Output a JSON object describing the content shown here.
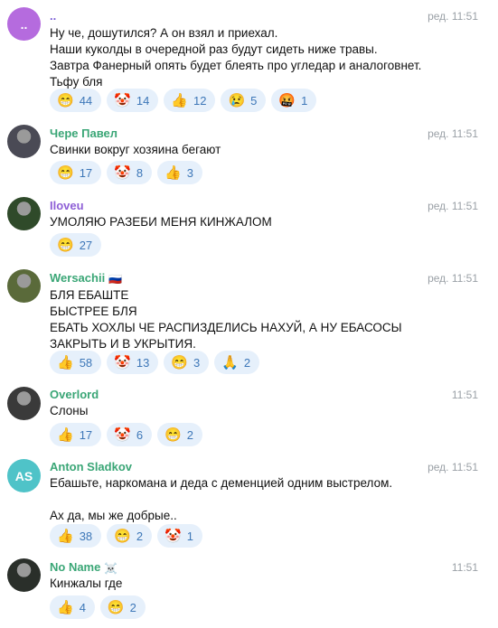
{
  "colors": {
    "reaction_bg": "#e6f0fb",
    "reaction_text": "#3d77b8",
    "time_text": "#9aa0a6"
  },
  "messages": [
    {
      "name": "..",
      "name_color": "#7b5fd6",
      "avatar_initials": "..",
      "avatar_color": "#b56bde",
      "avatar_icon": "dots-avatar",
      "time": "ред. 11:51",
      "text": "Ну че, дошутился? А он взял и приехал.\nНаши куколды в очередной раз будут сидеть ниже травы.\nЗавтра Фанерный опять будет блеять про угледар и аналоговнет.\nТьфу бля",
      "reactions": [
        {
          "emoji": "😁",
          "icon": "grin-icon",
          "count": "44"
        },
        {
          "emoji": "🤡",
          "icon": "clown-icon",
          "count": "14"
        },
        {
          "emoji": "👍",
          "icon": "thumbs-up-icon",
          "count": "12"
        },
        {
          "emoji": "😢",
          "icon": "crying-icon",
          "count": "5"
        },
        {
          "emoji": "🤬",
          "icon": "cursing-icon",
          "count": "1"
        }
      ]
    },
    {
      "name": "Чере Павел",
      "name_color": "#3aa676",
      "avatar_icon": "photo-avatar",
      "avatar_color": "#4a4a55",
      "time": "ред. 11:51",
      "text": "Свинки вокруг хозяина бегают",
      "reactions": [
        {
          "emoji": "😁",
          "icon": "grin-icon",
          "count": "17"
        },
        {
          "emoji": "🤡",
          "icon": "clown-icon",
          "count": "8"
        },
        {
          "emoji": "👍",
          "icon": "thumbs-up-icon",
          "count": "3"
        }
      ]
    },
    {
      "name": "Iloveu",
      "name_color": "#8e5fd6",
      "avatar_icon": "photo-avatar",
      "avatar_color": "#2f4a2a",
      "time": "ред. 11:51",
      "text": "УМОЛЯЮ РАЗЕБИ МЕНЯ КИНЖАЛОМ",
      "reactions": [
        {
          "emoji": "😁",
          "icon": "grin-icon",
          "count": "27"
        }
      ]
    },
    {
      "name": "Wersachii",
      "name_flag": "🇷🇺",
      "name_color": "#3aa676",
      "avatar_icon": "photo-avatar",
      "avatar_color": "#5a6a3a",
      "time": "ред. 11:51",
      "text": "БЛЯ ЕБАШТЕ\nБЫСТРЕЕ БЛЯ\nЕБАТЬ ХОХЛЫ ЧЕ РАСПИЗДЕЛИСЬ НАХУЙ, А НУ ЕБАСОСЫ\nЗАКРЫТЬ И В УКРЫТИЯ.",
      "reactions": [
        {
          "emoji": "👍",
          "icon": "thumbs-up-icon",
          "count": "58"
        },
        {
          "emoji": "🤡",
          "icon": "clown-icon",
          "count": "13"
        },
        {
          "emoji": "😁",
          "icon": "grin-icon",
          "count": "3"
        },
        {
          "emoji": "🙏",
          "icon": "pray-icon",
          "count": "2"
        }
      ]
    },
    {
      "name": "Overlord",
      "name_color": "#3aa676",
      "avatar_icon": "photo-avatar",
      "avatar_color": "#3a3a3a",
      "time": "11:51",
      "text": "Слоны",
      "reactions": [
        {
          "emoji": "👍",
          "icon": "thumbs-up-icon",
          "count": "17"
        },
        {
          "emoji": "🤡",
          "icon": "clown-icon",
          "count": "6"
        },
        {
          "emoji": "😁",
          "icon": "grin-icon",
          "count": "2"
        }
      ]
    },
    {
      "name": "Anton Sladkov",
      "name_color": "#3aa676",
      "avatar_initials": "AS",
      "avatar_color": "#4fc3c8",
      "time": "ред. 11:51",
      "text": "Ебашьте, наркомана и деда с деменцией одним выстрелом.\n\nАх да, мы же добрые..",
      "reactions": [
        {
          "emoji": "👍",
          "icon": "thumbs-up-icon",
          "count": "38"
        },
        {
          "emoji": "😁",
          "icon": "grin-icon",
          "count": "2"
        },
        {
          "emoji": "🤡",
          "icon": "clown-icon",
          "count": "1"
        }
      ]
    },
    {
      "name": "No Name",
      "name_flag": "☠️",
      "name_color": "#3aa676",
      "avatar_icon": "photo-avatar",
      "avatar_color": "#2a2f2a",
      "time": "11:51",
      "text": "Кинжалы где",
      "reactions": [
        {
          "emoji": "👍",
          "icon": "thumbs-up-icon",
          "count": "4"
        },
        {
          "emoji": "😁",
          "icon": "grin-icon",
          "count": "2"
        }
      ]
    }
  ]
}
